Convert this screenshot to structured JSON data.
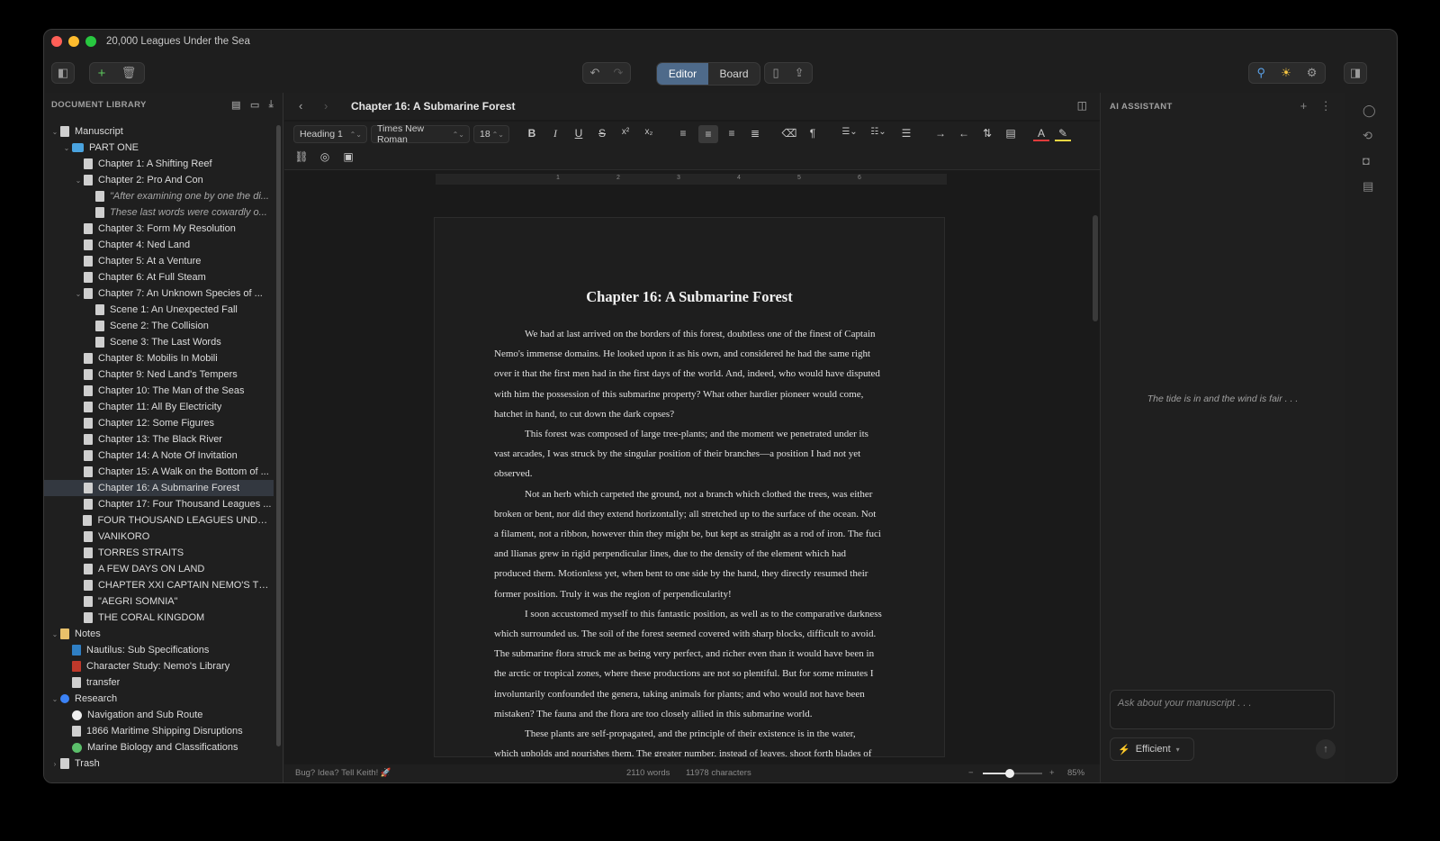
{
  "window": {
    "title": "20,000 Leagues Under the Sea"
  },
  "toolbar": {
    "mode_editor": "Editor",
    "mode_board": "Board"
  },
  "sidebar": {
    "heading": "DOCUMENT LIBRARY",
    "items": [
      {
        "label": "Manuscript",
        "level": 0,
        "chev": "⌄",
        "icon": "doc"
      },
      {
        "label": "PART ONE",
        "level": 1,
        "chev": "⌄",
        "icon": "folder"
      },
      {
        "label": "Chapter 1: A Shifting Reef",
        "level": 2,
        "chev": "",
        "icon": "doc"
      },
      {
        "label": "Chapter 2: Pro And Con",
        "level": 2,
        "chev": "⌄",
        "icon": "doc"
      },
      {
        "label": "\"After examining one by one the di...",
        "level": 3,
        "chev": "",
        "icon": "doc",
        "italic": true
      },
      {
        "label": "These last words were cowardly o...",
        "level": 3,
        "chev": "",
        "icon": "doc",
        "italic": true
      },
      {
        "label": "Chapter 3: Form My Resolution",
        "level": 2,
        "chev": "",
        "icon": "doc"
      },
      {
        "label": "Chapter 4: Ned Land",
        "level": 2,
        "chev": "",
        "icon": "doc"
      },
      {
        "label": "Chapter 5: At a Venture",
        "level": 2,
        "chev": "",
        "icon": "doc"
      },
      {
        "label": "Chapter 6: At Full Steam",
        "level": 2,
        "chev": "",
        "icon": "doc"
      },
      {
        "label": "Chapter 7: An Unknown Species of ...",
        "level": 2,
        "chev": "⌄",
        "icon": "doc"
      },
      {
        "label": "Scene 1: An Unexpected Fall",
        "level": 3,
        "chev": "",
        "icon": "doc"
      },
      {
        "label": "Scene 2: The Collision",
        "level": 3,
        "chev": "",
        "icon": "doc"
      },
      {
        "label": "Scene 3: The Last Words",
        "level": 3,
        "chev": "",
        "icon": "doc"
      },
      {
        "label": "Chapter 8: Mobilis In Mobili",
        "level": 2,
        "chev": "",
        "icon": "doc"
      },
      {
        "label": "Chapter 9: Ned Land's Tempers",
        "level": 2,
        "chev": "",
        "icon": "doc"
      },
      {
        "label": "Chapter 10: The Man of the Seas",
        "level": 2,
        "chev": "",
        "icon": "doc"
      },
      {
        "label": "Chapter 11: All By Electricity",
        "level": 2,
        "chev": "",
        "icon": "doc"
      },
      {
        "label": "Chapter 12: Some Figures",
        "level": 2,
        "chev": "",
        "icon": "doc"
      },
      {
        "label": "Chapter 13: The Black River",
        "level": 2,
        "chev": "",
        "icon": "doc"
      },
      {
        "label": "Chapter 14: A Note Of Invitation",
        "level": 2,
        "chev": "",
        "icon": "doc"
      },
      {
        "label": "Chapter 15: A Walk on the Bottom of ...",
        "level": 2,
        "chev": "",
        "icon": "doc"
      },
      {
        "label": "Chapter 16: A Submarine Forest",
        "level": 2,
        "chev": "",
        "icon": "doc",
        "selected": true
      },
      {
        "label": "Chapter 17: Four Thousand Leagues ...",
        "level": 2,
        "chev": "",
        "icon": "doc"
      },
      {
        "label": "FOUR THOUSAND LEAGUES UNDER ...",
        "level": 2,
        "chev": "",
        "icon": "doc"
      },
      {
        "label": "VANIKORO",
        "level": 2,
        "chev": "",
        "icon": "doc"
      },
      {
        "label": "TORRES STRAITS",
        "level": 2,
        "chev": "",
        "icon": "doc"
      },
      {
        "label": "A FEW DAYS ON LAND",
        "level": 2,
        "chev": "",
        "icon": "doc"
      },
      {
        "label": "CHAPTER XXI CAPTAIN NEMO'S TH...",
        "level": 2,
        "chev": "",
        "icon": "doc"
      },
      {
        "label": "\"AEGRI SOMNIA\"",
        "level": 2,
        "chev": "",
        "icon": "doc"
      },
      {
        "label": "THE CORAL KINGDOM",
        "level": 2,
        "chev": "",
        "icon": "doc"
      },
      {
        "label": "Notes",
        "level": 0,
        "chev": "⌄",
        "icon": "note"
      },
      {
        "label": "Nautilus: Sub Specifications",
        "level": 1,
        "chev": "",
        "icon": "book-blue"
      },
      {
        "label": "Character Study: Nemo's Library",
        "level": 1,
        "chev": "",
        "icon": "book-red"
      },
      {
        "label": "transfer",
        "level": 1,
        "chev": "",
        "icon": "doc"
      },
      {
        "label": "Research",
        "level": 0,
        "chev": "⌄",
        "icon": "pin"
      },
      {
        "label": "Navigation and Sub Route",
        "level": 1,
        "chev": "",
        "icon": "compass"
      },
      {
        "label": "1866 Maritime Shipping Disruptions",
        "level": 1,
        "chev": "",
        "icon": "doc"
      },
      {
        "label": "Marine Biology and Classifications",
        "level": 1,
        "chev": "",
        "icon": "globe"
      },
      {
        "label": "Trash",
        "level": 0,
        "chev": "›",
        "icon": "doc"
      }
    ]
  },
  "editor": {
    "title": "Chapter 16: A Submarine Forest",
    "style_select": "Heading 1",
    "font_select": "Times New Roman",
    "size_select": "18",
    "ruler_marks": [
      "1",
      "2",
      "3",
      "4",
      "5",
      "6"
    ],
    "doc_title": "Chapter 16: A Submarine Forest",
    "paragraphs": [
      "We had at last arrived on the borders of this forest, doubtless one of the finest of Captain Nemo's immense domains. He looked upon it as his own, and considered he had the same right over it that the first men had in the first days of the world. And, indeed, who would have disputed with him the possession of this submarine property? What other hardier pioneer would come, hatchet in hand, to cut down the dark copses?",
      "This forest was composed of large tree-plants; and the moment we penetrated under its vast arcades, I was struck by the singular position of their branches—a position I had not yet observed.",
      "Not an herb which carpeted the ground, not a branch which clothed the trees, was either broken or bent, nor did they extend horizontally; all stretched up to the surface of the ocean. Not a filament, not a ribbon, however thin they might be, but kept as straight as a rod of iron. The fuci and llianas grew in rigid perpendicular lines, due to the density of the element which had produced them. Motionless yet, when bent to one side by the hand, they directly resumed their former position. Truly it was the region of perpendicularity!",
      "I soon accustomed myself to this fantastic position, as well as to the comparative darkness which surrounded us. The soil of the forest seemed covered with sharp blocks, difficult to avoid. The submarine flora struck me as being very perfect, and richer even than it would have been in the arctic or tropical zones, where these productions are not so plentiful. But for some minutes I involuntarily confounded the genera, taking animals for plants; and who would not have been mistaken? The fauna and the flora are too closely allied in this submarine world.",
      "These plants are self-propagated, and the principle of their existence is in the water, which upholds and nourishes them. The greater number, instead of leaves, shoot forth blades of"
    ],
    "status": {
      "feedback": "Bug? Idea? Tell Keith! 🚀",
      "words": "2110 words",
      "chars": "11978 characters",
      "zoom": "85%",
      "zoom_level": 0.45
    }
  },
  "assistant": {
    "heading": "AI ASSISTANT",
    "placeholder_msg": "The tide is in and the wind is fair . . .",
    "input_placeholder": "Ask about your manuscript . . .",
    "mode": "Efficient"
  },
  "colors": {
    "accent": "#4e6a8a",
    "close": "#ff5f57",
    "minimize": "#febc2e",
    "maximize": "#28c840"
  }
}
